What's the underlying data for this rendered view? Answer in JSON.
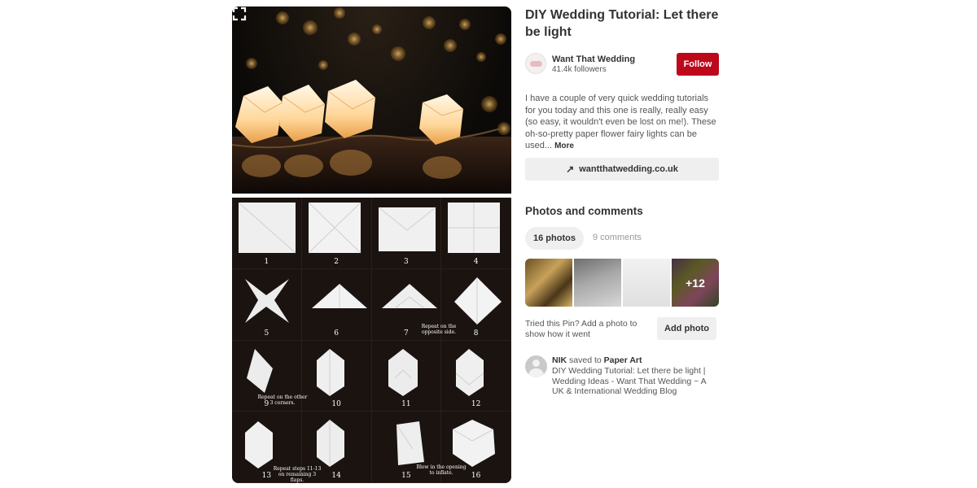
{
  "pin": {
    "title": "DIY Wedding Tutorial: Let there be light",
    "creator": {
      "name": "Want That Wedding",
      "followers": "41.4k followers",
      "follow_label": "Follow"
    },
    "description": "I have a couple of very quick wedding tutorials for you today and this one is really, really easy (so easy, it wouldn't even be lost on me!). These oh-so-pretty paper flower fairy lights can be used...",
    "more_label": "More",
    "source_link": "wantthatwedding.co.uk"
  },
  "image": {
    "steps": [
      "1",
      "2",
      "3",
      "4",
      "5",
      "6",
      "7",
      "8",
      "9",
      "10",
      "11",
      "12",
      "13",
      "14",
      "15",
      "16"
    ],
    "notes": {
      "repeat_opposite": "Repeat on the opposite side.",
      "repeat_corners": "Repeat on the other 3 corners.",
      "repeat_steps": "Repeat steps 11-13 on remaining 3 flaps.",
      "blow": "Blow in the opening to inflate."
    }
  },
  "photos_comments": {
    "section_title": "Photos and comments",
    "photos_tab": "16 photos",
    "comments_tab": "9 comments",
    "more_count": "+12",
    "tried_text": "Tried this Pin? Add a photo to show how it went",
    "add_photo_label": "Add photo"
  },
  "activity": {
    "user": "NIK",
    "action": "saved to",
    "board": "Paper Art",
    "pin_text": "DIY Wedding Tutorial: Let there be light | Wedding Ideas - Want That Wedding ~ A UK & International Wedding Blog"
  },
  "colors": {
    "follow_red": "#bd081c",
    "button_gray": "#efefef"
  }
}
